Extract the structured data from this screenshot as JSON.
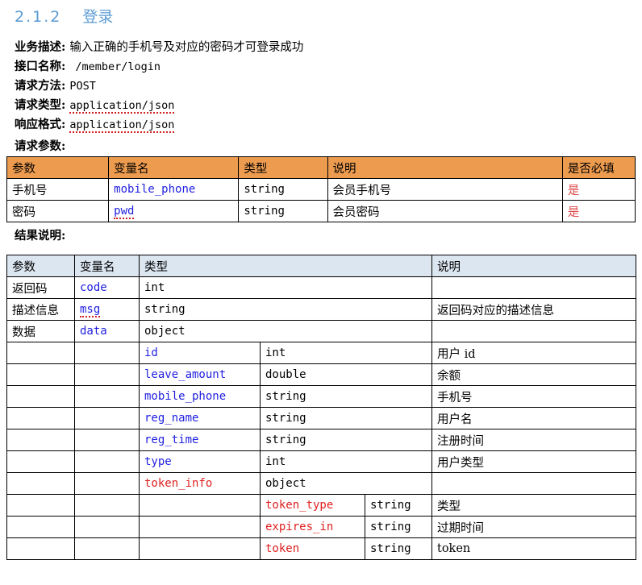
{
  "heading": {
    "number": "2.1.2",
    "title": "登录"
  },
  "meta": [
    {
      "label": "业务描述:",
      "value": "输入正确的手机号及对应的密码才可登录成功",
      "mono": false,
      "spell": false,
      "indent": false
    },
    {
      "label": "接口名称:",
      "value": "/member/login",
      "mono": true,
      "spell": false,
      "indent": true
    },
    {
      "label": "请求方法:",
      "value": "POST",
      "mono": true,
      "spell": false,
      "indent": false
    },
    {
      "label": "请求类型:",
      "value": "application/json",
      "mono": true,
      "spell": true,
      "indent": false
    },
    {
      "label": "响应格式:",
      "value": "application/json",
      "mono": true,
      "spell": true,
      "indent": false
    }
  ],
  "request_section_label": "请求参数:",
  "result_section_label": "结果说明:",
  "request_table": {
    "headers": [
      "参数",
      "变量名",
      "类型",
      "说明",
      "是否必填"
    ],
    "rows": [
      {
        "param": "手机号",
        "var": "mobile_phone",
        "type": "string",
        "desc": "会员手机号",
        "required": "是"
      },
      {
        "param": "密码",
        "var": "pwd",
        "type": "string",
        "desc": "会员密码",
        "required": "是"
      }
    ]
  },
  "result_table": {
    "headers": [
      "参数",
      "变量名",
      "类型",
      "说明"
    ],
    "rows": [
      {
        "param": "返回码",
        "var": "code",
        "var_color": "blue",
        "type": "int",
        "desc": "",
        "level": 0
      },
      {
        "param": "描述信息",
        "var": "msg",
        "var_color": "blue",
        "type": "string",
        "desc": "返回码对应的描述信息",
        "level": 0
      },
      {
        "param": "数据",
        "var": "data",
        "var_color": "blue",
        "type": "object",
        "desc": "",
        "level": 0
      },
      {
        "param": "",
        "var": "id",
        "var_color": "blue",
        "type": "int",
        "desc": "用户 id",
        "level": 1
      },
      {
        "param": "",
        "var": "leave_amount",
        "var_color": "blue",
        "type": "double",
        "desc": "余额",
        "level": 1
      },
      {
        "param": "",
        "var": "mobile_phone",
        "var_color": "blue",
        "type": "string",
        "desc": "手机号",
        "level": 1
      },
      {
        "param": "",
        "var": "reg_name",
        "var_color": "blue",
        "type": "string",
        "desc": "用户名",
        "level": 1
      },
      {
        "param": "",
        "var": "reg_time",
        "var_color": "blue",
        "type": "string",
        "desc": "注册时间",
        "level": 1
      },
      {
        "param": "",
        "var": "type",
        "var_color": "blue",
        "type": "int",
        "desc": "用户类型",
        "level": 1
      },
      {
        "param": "",
        "var": "token_info",
        "var_color": "red",
        "type": "object",
        "desc": "",
        "level": 1
      },
      {
        "param": "",
        "var": "token_type",
        "var_color": "red",
        "type": "string",
        "desc": "类型",
        "level": 2
      },
      {
        "param": "",
        "var": "expires_in",
        "var_color": "red",
        "type": "string",
        "desc": "过期时间",
        "level": 2
      },
      {
        "param": "",
        "var": "token",
        "var_color": "red",
        "type": "string",
        "desc": "token",
        "level": 2
      }
    ]
  },
  "colors": {
    "heading": "#5b9bd5",
    "table1_header_bg": "#ed9b4f",
    "table2_header_bg": "#dce6f1",
    "var_blue": "#1f1fe0",
    "var_red": "#e02020",
    "required_red": "#e04a4a"
  }
}
